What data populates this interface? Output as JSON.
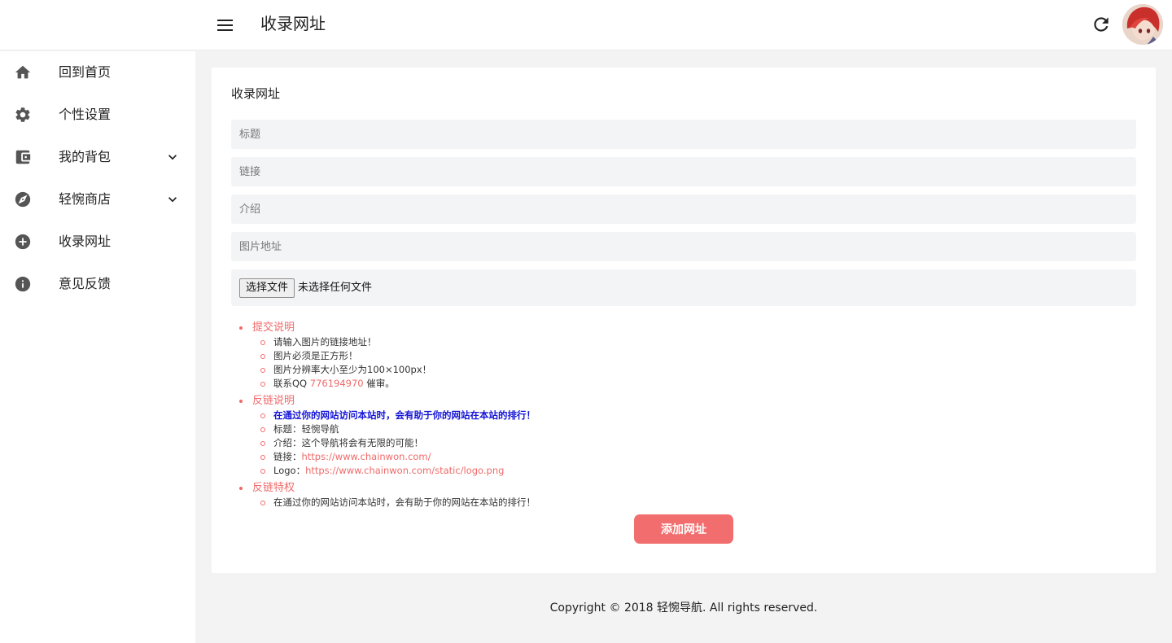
{
  "header": {
    "title": "收录网址",
    "menu_icon": "menu-icon",
    "refresh_icon": "refresh-icon"
  },
  "sidebar": {
    "items": [
      {
        "label": "回到首页",
        "icon": "home-icon"
      },
      {
        "label": "个性设置",
        "icon": "gear-icon"
      },
      {
        "label": "我的背包",
        "icon": "wallet-icon",
        "expandable": true
      },
      {
        "label": "轻惋商店",
        "icon": "compass-icon",
        "expandable": true
      },
      {
        "label": "收录网址",
        "icon": "add-circle-icon"
      },
      {
        "label": "意见反馈",
        "icon": "info-icon"
      }
    ]
  },
  "form": {
    "title": "收录网址",
    "title_placeholder": "标题",
    "link_placeholder": "链接",
    "intro_placeholder": "介绍",
    "image_placeholder": "图片地址",
    "file_button": "选择文件",
    "file_status": "未选择任何文件",
    "submit_label": "添加网址"
  },
  "notes": {
    "submit": {
      "title": "提交说明",
      "items": [
        "请输入图片的链接地址！",
        "图片必须是正方形！",
        "图片分辨率大小至少为100×100px！"
      ],
      "contact_prefix": "联系QQ ",
      "contact_qq": "776194970",
      "contact_suffix": " 催审。"
    },
    "backlink": {
      "title": "反链说明",
      "highlight": "在通过你的网站访问本站时，会有助于你的网站在本站的排行！",
      "name": "标题：轻惋导航",
      "intro": "介绍：这个导航将会有无限的可能！",
      "link_prefix": "链接：",
      "link_url": "https://www.chainwon.com/",
      "logo_prefix": "Logo：",
      "logo_url": "https://www.chainwon.com/static/logo.png"
    },
    "privilege": {
      "title": "反链特权",
      "items": [
        "在通过你的网站访问本站时，会有助于你的网站在本站的排行！"
      ]
    }
  },
  "footer": {
    "text": "Copyright © 2018 轻惋导航. All rights reserved."
  },
  "colors": {
    "accent": "#f26e6e",
    "note_red": "#f06a6a",
    "highlight_blue": "#1414d8"
  }
}
